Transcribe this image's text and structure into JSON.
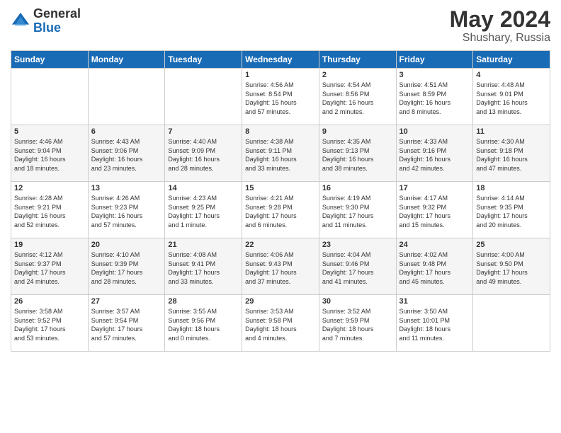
{
  "logo": {
    "general": "General",
    "blue": "Blue"
  },
  "header": {
    "month_year": "May 2024",
    "location": "Shushary, Russia"
  },
  "days_of_week": [
    "Sunday",
    "Monday",
    "Tuesday",
    "Wednesday",
    "Thursday",
    "Friday",
    "Saturday"
  ],
  "weeks": [
    [
      {
        "day": "",
        "info": ""
      },
      {
        "day": "",
        "info": ""
      },
      {
        "day": "",
        "info": ""
      },
      {
        "day": "1",
        "info": "Sunrise: 4:56 AM\nSunset: 8:54 PM\nDaylight: 15 hours\nand 57 minutes."
      },
      {
        "day": "2",
        "info": "Sunrise: 4:54 AM\nSunset: 8:56 PM\nDaylight: 16 hours\nand 2 minutes."
      },
      {
        "day": "3",
        "info": "Sunrise: 4:51 AM\nSunset: 8:59 PM\nDaylight: 16 hours\nand 8 minutes."
      },
      {
        "day": "4",
        "info": "Sunrise: 4:48 AM\nSunset: 9:01 PM\nDaylight: 16 hours\nand 13 minutes."
      }
    ],
    [
      {
        "day": "5",
        "info": "Sunrise: 4:46 AM\nSunset: 9:04 PM\nDaylight: 16 hours\nand 18 minutes."
      },
      {
        "day": "6",
        "info": "Sunrise: 4:43 AM\nSunset: 9:06 PM\nDaylight: 16 hours\nand 23 minutes."
      },
      {
        "day": "7",
        "info": "Sunrise: 4:40 AM\nSunset: 9:09 PM\nDaylight: 16 hours\nand 28 minutes."
      },
      {
        "day": "8",
        "info": "Sunrise: 4:38 AM\nSunset: 9:11 PM\nDaylight: 16 hours\nand 33 minutes."
      },
      {
        "day": "9",
        "info": "Sunrise: 4:35 AM\nSunset: 9:13 PM\nDaylight: 16 hours\nand 38 minutes."
      },
      {
        "day": "10",
        "info": "Sunrise: 4:33 AM\nSunset: 9:16 PM\nDaylight: 16 hours\nand 42 minutes."
      },
      {
        "day": "11",
        "info": "Sunrise: 4:30 AM\nSunset: 9:18 PM\nDaylight: 16 hours\nand 47 minutes."
      }
    ],
    [
      {
        "day": "12",
        "info": "Sunrise: 4:28 AM\nSunset: 9:21 PM\nDaylight: 16 hours\nand 52 minutes."
      },
      {
        "day": "13",
        "info": "Sunrise: 4:26 AM\nSunset: 9:23 PM\nDaylight: 16 hours\nand 57 minutes."
      },
      {
        "day": "14",
        "info": "Sunrise: 4:23 AM\nSunset: 9:25 PM\nDaylight: 17 hours\nand 1 minute."
      },
      {
        "day": "15",
        "info": "Sunrise: 4:21 AM\nSunset: 9:28 PM\nDaylight: 17 hours\nand 6 minutes."
      },
      {
        "day": "16",
        "info": "Sunrise: 4:19 AM\nSunset: 9:30 PM\nDaylight: 17 hours\nand 11 minutes."
      },
      {
        "day": "17",
        "info": "Sunrise: 4:17 AM\nSunset: 9:32 PM\nDaylight: 17 hours\nand 15 minutes."
      },
      {
        "day": "18",
        "info": "Sunrise: 4:14 AM\nSunset: 9:35 PM\nDaylight: 17 hours\nand 20 minutes."
      }
    ],
    [
      {
        "day": "19",
        "info": "Sunrise: 4:12 AM\nSunset: 9:37 PM\nDaylight: 17 hours\nand 24 minutes."
      },
      {
        "day": "20",
        "info": "Sunrise: 4:10 AM\nSunset: 9:39 PM\nDaylight: 17 hours\nand 28 minutes."
      },
      {
        "day": "21",
        "info": "Sunrise: 4:08 AM\nSunset: 9:41 PM\nDaylight: 17 hours\nand 33 minutes."
      },
      {
        "day": "22",
        "info": "Sunrise: 4:06 AM\nSunset: 9:43 PM\nDaylight: 17 hours\nand 37 minutes."
      },
      {
        "day": "23",
        "info": "Sunrise: 4:04 AM\nSunset: 9:46 PM\nDaylight: 17 hours\nand 41 minutes."
      },
      {
        "day": "24",
        "info": "Sunrise: 4:02 AM\nSunset: 9:48 PM\nDaylight: 17 hours\nand 45 minutes."
      },
      {
        "day": "25",
        "info": "Sunrise: 4:00 AM\nSunset: 9:50 PM\nDaylight: 17 hours\nand 49 minutes."
      }
    ],
    [
      {
        "day": "26",
        "info": "Sunrise: 3:58 AM\nSunset: 9:52 PM\nDaylight: 17 hours\nand 53 minutes."
      },
      {
        "day": "27",
        "info": "Sunrise: 3:57 AM\nSunset: 9:54 PM\nDaylight: 17 hours\nand 57 minutes."
      },
      {
        "day": "28",
        "info": "Sunrise: 3:55 AM\nSunset: 9:56 PM\nDaylight: 18 hours\nand 0 minutes."
      },
      {
        "day": "29",
        "info": "Sunrise: 3:53 AM\nSunset: 9:58 PM\nDaylight: 18 hours\nand 4 minutes."
      },
      {
        "day": "30",
        "info": "Sunrise: 3:52 AM\nSunset: 9:59 PM\nDaylight: 18 hours\nand 7 minutes."
      },
      {
        "day": "31",
        "info": "Sunrise: 3:50 AM\nSunset: 10:01 PM\nDaylight: 18 hours\nand 11 minutes."
      },
      {
        "day": "",
        "info": ""
      }
    ]
  ]
}
